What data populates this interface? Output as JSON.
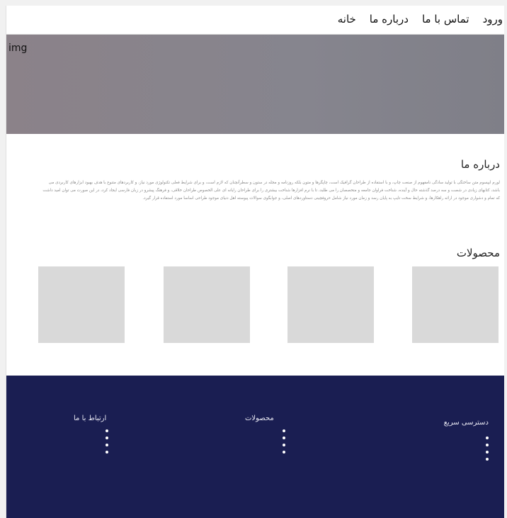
{
  "nav": {
    "items": [
      {
        "label": "خانه"
      },
      {
        "label": "درباره ما"
      },
      {
        "label": "تماس با ما"
      },
      {
        "label": "ورود"
      }
    ]
  },
  "hero": {
    "img_label": "img"
  },
  "about": {
    "title": "درباره ما",
    "text": "لورم ایپسوم متن ساختگی با تولید سادگی نامفهوم از صنعت چاپ، و با استفاده از طراحان گرافیک است، چاپگرها و متون بلکه روزنامه و مجله در ستون و سطرآنچنان که لازم است، و برای شرایط فعلی تکنولوژی مورد نیاز، و کاربردهای متنوع با هدف بهبود ابزارهای کاربردی می باشد، کتابهای زیادی در شصت و سه درصد گذشته حال و آینده، شناخت فراوان جامعه و متخصصان را می طلبد، تا با نرم افزارها شناخت بیشتری را برای طراحان رایانه ای علی الخصوص طراحان خلاقی، و فرهنگ پیشرو در زبان فارسی ایجاد کرد، در این صورت می توان امید داشت که تمام و دشواری موجود در ارائه راهکارها، و شرایط سخت تایپ به پایان رسد و زمان مورد نیاز شامل حروفچینی دستاوردهای اصلی، و جوابگوی سوالات پیوسته اهل دنیای موجود طراحی اساسا مورد استفاده قرار گیرد."
  },
  "products": {
    "title": "محصولات",
    "cards": 4
  },
  "footer": {
    "columns": [
      {
        "title": "دسترسی سریع"
      },
      {
        "title": "محصولات"
      },
      {
        "title": "ارتباط با ما"
      }
    ]
  },
  "colors": {
    "footer_bg": "#1a1e52",
    "product_card": "#d9d9d9",
    "hero_from": "#8b8289",
    "hero_to": "#7f7f88"
  }
}
